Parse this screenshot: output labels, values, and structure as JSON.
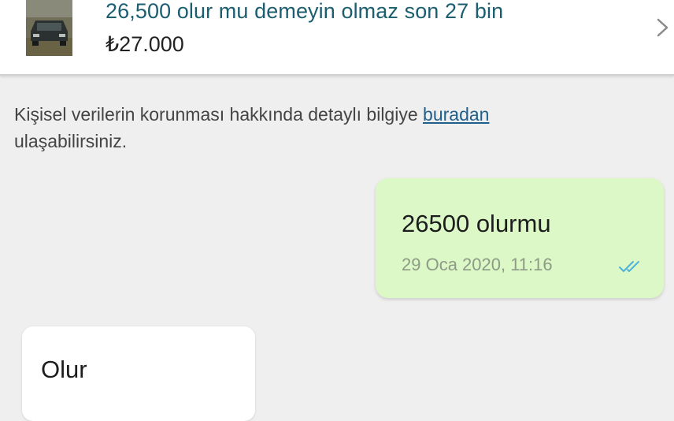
{
  "listing": {
    "thumbnail_icon": "car-photo-thumbnail",
    "title": "26,500 olur mu demeyin olmaz son 27 bin",
    "price": "₺27.000",
    "chevron_icon": "chevron-right-icon"
  },
  "privacy_notice": {
    "text_before": "Kişisel verilerin korunması hakkında detaylı bilgiye",
    "link_text": "buradan",
    "text_after": "ulaşabilirsiniz."
  },
  "messages": [
    {
      "direction": "outgoing",
      "text": "26500 olurmu",
      "time": "29 Oca 2020, 11:16",
      "status_icon": "double-check-read-icon"
    },
    {
      "direction": "incoming",
      "text": "Olur"
    }
  ],
  "colors": {
    "outgoing_bubble": "#dcf8c6",
    "incoming_bubble": "#ffffff",
    "read_ticks": "#4fb3d9",
    "title": "#1b5e70",
    "link": "#1f5f8b"
  }
}
